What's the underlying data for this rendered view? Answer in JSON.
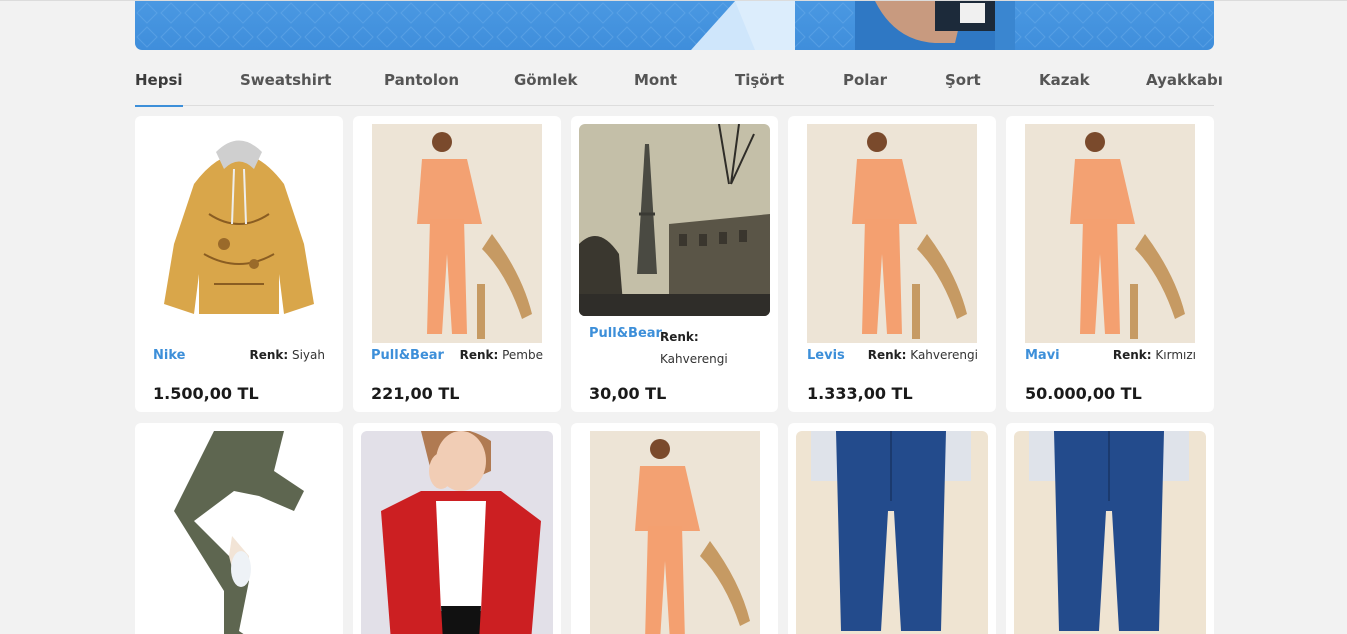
{
  "tabs": [
    {
      "label": "Hepsi",
      "active": true
    },
    {
      "label": "Sweatshirt"
    },
    {
      "label": "Pantolon"
    },
    {
      "label": "Gömlek"
    },
    {
      "label": "Mont"
    },
    {
      "label": "Tişört"
    },
    {
      "label": "Polar"
    },
    {
      "label": "Şort"
    },
    {
      "label": "Kazak"
    },
    {
      "label": "Ayakkabı"
    }
  ],
  "color_label": "Renk:",
  "products": [
    {
      "brand": "Nike",
      "color": "Siyah",
      "price": "1.500,00 TL",
      "image": "hoodie-map"
    },
    {
      "brand": "Pull&Bear",
      "color": "Pembe",
      "price": "221,00 TL",
      "image": "peach-suit"
    },
    {
      "brand": "Pull&Bear",
      "color": "Kahverengi",
      "price": "30,00 TL",
      "image": "eiffel-photo"
    },
    {
      "brand": "Levis",
      "color": "Kahverengi",
      "price": "1.333,00 TL",
      "image": "peach-suit"
    },
    {
      "brand": "Mavi",
      "color": "Kırmızı",
      "price": "50.000,00 TL",
      "image": "peach-suit"
    },
    {
      "image": "green-jogger"
    },
    {
      "image": "red-blazer"
    },
    {
      "image": "peach-suit"
    },
    {
      "image": "blue-jeans"
    },
    {
      "image": "blue-jeans"
    }
  ],
  "colors": {
    "accent": "#3d8fd9",
    "background": "#f2f2f2",
    "banner": "#4a98e2"
  }
}
